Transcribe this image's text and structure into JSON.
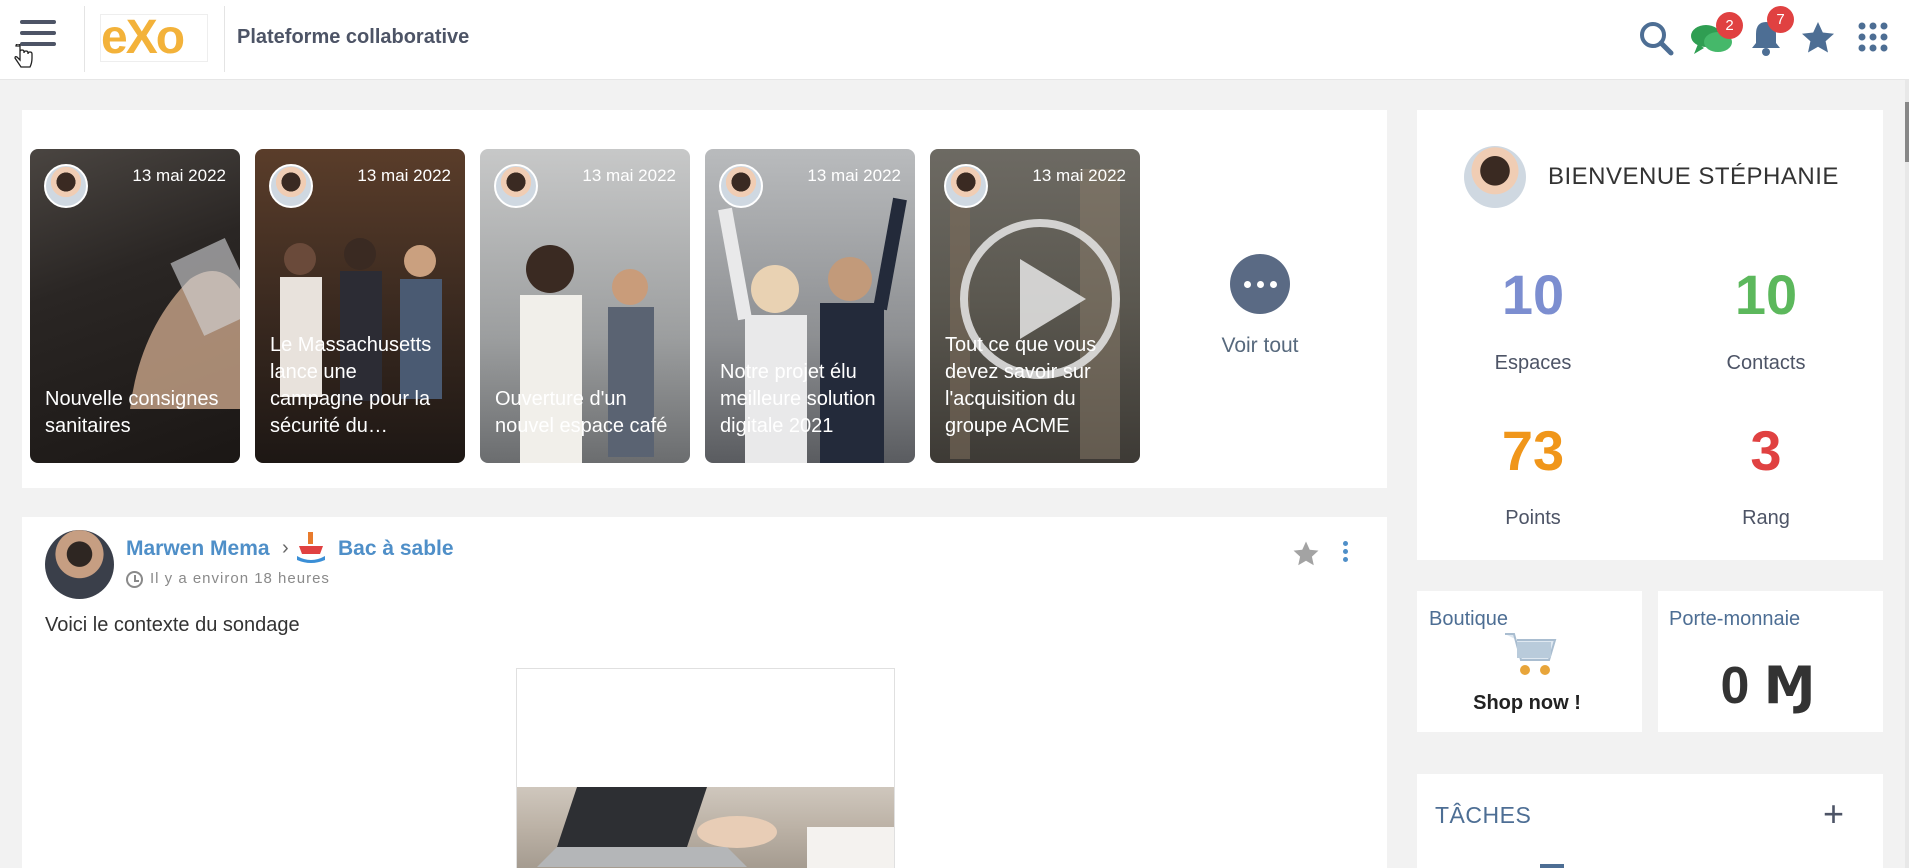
{
  "header": {
    "platform_title": "Plateforme collaborative",
    "logo_text": "eXo",
    "chat_badge": "2",
    "notif_badge": "7"
  },
  "news": {
    "items": [
      {
        "date": "13 mai 2022",
        "title": "Nouvelle consignes sanitaires"
      },
      {
        "date": "13 mai 2022",
        "title": "Le Massachusetts lance une campagne pour la sécurité du…"
      },
      {
        "date": "13 mai 2022",
        "title": "Ouverture d'un nouvel espace café"
      },
      {
        "date": "13 mai 2022",
        "title": "Notre projet élu meilleure solution digitale 2021"
      },
      {
        "date": "13 mai 2022",
        "title": "Tout ce que vous devez savoir sur l'acquisition du groupe ACME"
      }
    ],
    "see_all": "Voir tout"
  },
  "activity": {
    "author": "Marwen Mema",
    "space": "Bac à sable",
    "time": "Il y a environ 18 heures",
    "text": "Voici le contexte du sondage"
  },
  "welcome": {
    "title": "BIENVENUE STÉPHANIE",
    "stats": [
      {
        "value": "10",
        "label": "Espaces",
        "color": "#7c8ed0"
      },
      {
        "value": "10",
        "label": "Contacts",
        "color": "#5cb85c"
      },
      {
        "value": "73",
        "label": "Points",
        "color": "#f0961a"
      },
      {
        "value": "3",
        "label": "Rang",
        "color": "#e04141"
      }
    ]
  },
  "shop": {
    "title": "Boutique",
    "cta": "Shop now !"
  },
  "wallet": {
    "title": "Porte-monnaie",
    "value": "0 Ɱ"
  },
  "tasks": {
    "title": "TÂCHES",
    "add": "+"
  },
  "colors": {
    "accent": "#4f8fc8",
    "badge": "#e04141",
    "icon": "#4d6e94"
  }
}
